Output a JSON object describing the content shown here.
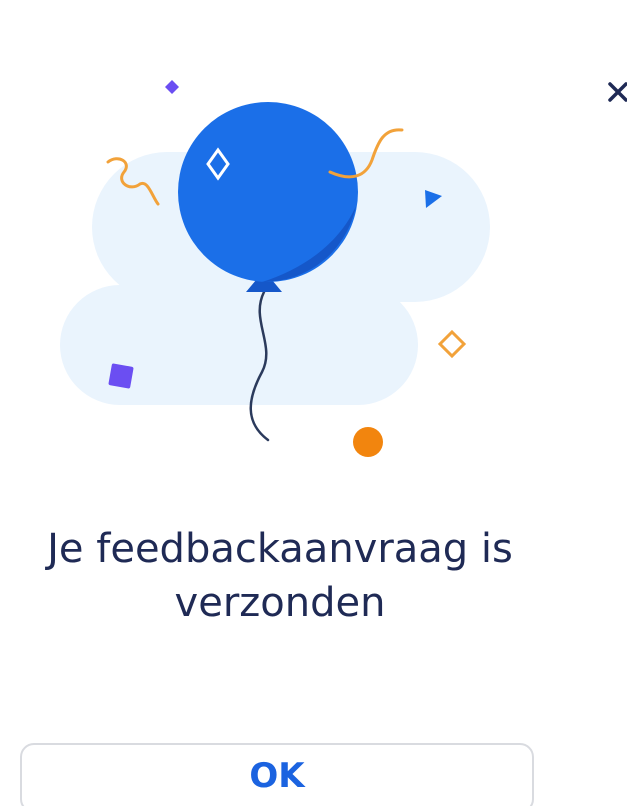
{
  "dialog": {
    "title_line1": "Je feedbackaanvraag is",
    "title_line2": "verzonden",
    "ok_label": "OK"
  },
  "icons": {
    "close": "close-icon",
    "illustration": "balloon-confetti-illustration"
  },
  "colors": {
    "balloon": "#1b6fe8",
    "cloud": "#eaf4fd",
    "confetti_orange": "#f2a23a",
    "confetti_purple": "#6b4ef2",
    "title_text": "#1f2a55",
    "button_text": "#1b63e0",
    "button_border": "#d9dbe0"
  }
}
